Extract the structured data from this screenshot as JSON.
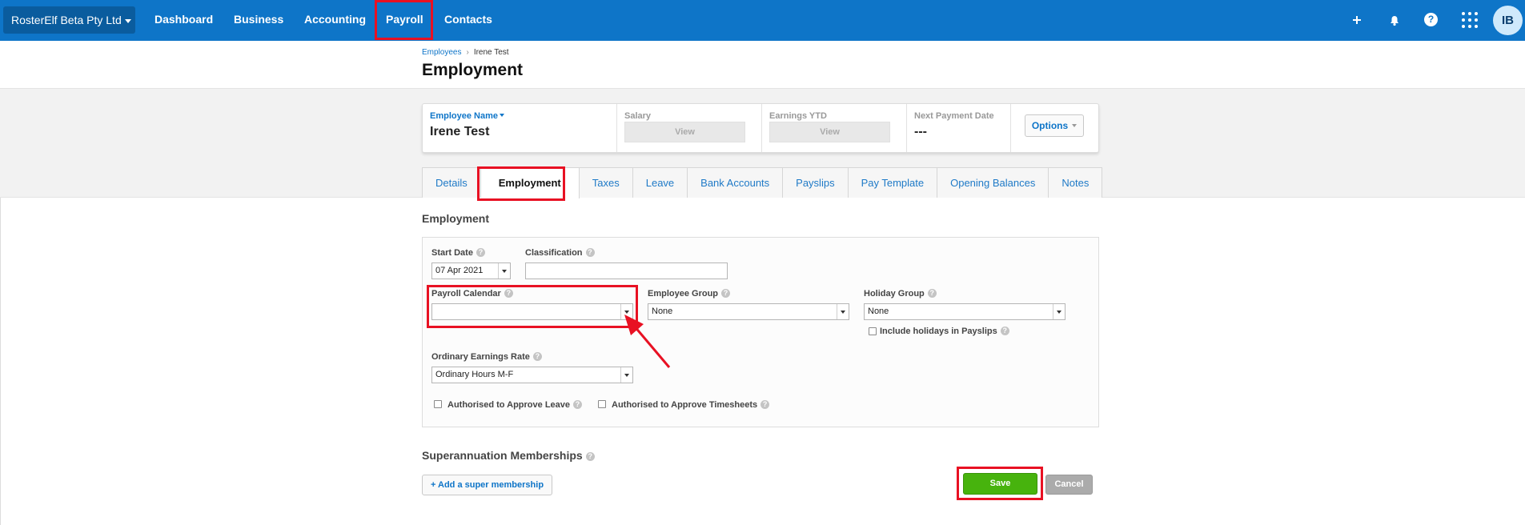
{
  "topbar": {
    "org_name": "RosterElf Beta Pty Ltd",
    "nav": [
      "Dashboard",
      "Business",
      "Accounting",
      "Payroll",
      "Contacts"
    ],
    "icons": [
      "plus-icon",
      "bell-icon",
      "help-icon",
      "app-grid-icon"
    ],
    "avatar_initials": "IB"
  },
  "breadcrumb": {
    "parent": "Employees",
    "separator": "›",
    "current": "Irene Test"
  },
  "page_title": "Employment",
  "summary": {
    "employee_label": "Employee Name",
    "employee_name": "Irene Test",
    "salary_label": "Salary",
    "salary_button": "View",
    "earnings_label": "Earnings YTD",
    "earnings_button": "View",
    "next_payment_label": "Next Payment Date",
    "next_payment_value": "---",
    "options_label": "Options"
  },
  "tabs": [
    "Details",
    "Employment",
    "Taxes",
    "Leave",
    "Bank Accounts",
    "Payslips",
    "Pay Template",
    "Opening Balances",
    "Notes"
  ],
  "active_tab": "Employment",
  "form": {
    "section_title": "Employment",
    "start_date_label": "Start Date",
    "start_date_value": "07 Apr 2021",
    "classification_label": "Classification",
    "classification_value": "",
    "payroll_calendar_label": "Payroll Calendar",
    "payroll_calendar_value": "",
    "employee_group_label": "Employee Group",
    "employee_group_value": "None",
    "holiday_group_label": "Holiday Group",
    "holiday_group_value": "None",
    "include_holidays_label": "Include holidays in Payslips",
    "ordinary_rate_label": "Ordinary Earnings Rate",
    "ordinary_rate_value": "Ordinary Hours M-F",
    "approve_leave_label": "Authorised to Approve Leave",
    "approve_timesheets_label": "Authorised to Approve Timesheets",
    "help_glyph": "?"
  },
  "super": {
    "title": "Superannuation Memberships",
    "add_button": "+ Add a super membership"
  },
  "actions": {
    "save": "Save",
    "cancel": "Cancel"
  },
  "colors": {
    "topbar": "#0e75c8",
    "highlight": "#e81123",
    "save": "#47b30d",
    "cancel": "#ababab"
  }
}
